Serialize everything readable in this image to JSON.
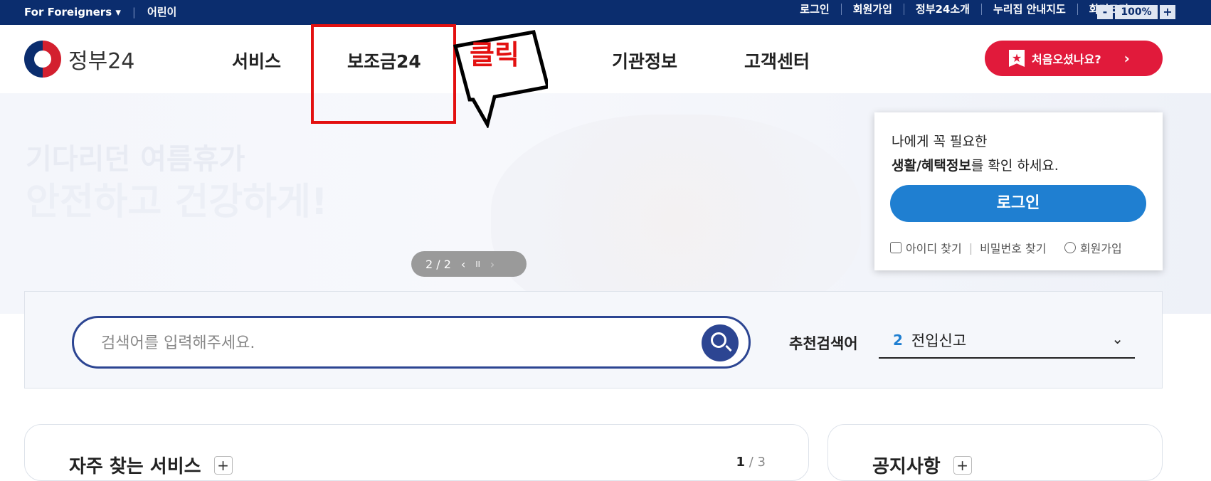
{
  "topbar": {
    "left": [
      "For Foreigners ▾",
      "어린이"
    ],
    "right": [
      "로그인",
      "회원가입",
      "정부24소개",
      "누리집 안내지도",
      "화면크기"
    ],
    "zoom": {
      "minus": "-",
      "value": "100%",
      "plus": "+"
    }
  },
  "header": {
    "logo_text": "정부24",
    "nav": [
      "서비스",
      "보조금24",
      "",
      "기관정보",
      "고객센터"
    ],
    "cta_label": "처음오셨나요?",
    "cta_arrow": "›"
  },
  "hero": {
    "ghost_line1": "기다리던 여름휴가",
    "ghost_line2": "안전하고 건강하게!",
    "pager": {
      "text": "2 / 2",
      "prev": "‹",
      "pause": "II",
      "next": "›"
    }
  },
  "login_card": {
    "line1": "나에게 꼭 필요한",
    "line2_bold": "생활/혜택정보",
    "line2_rest": "를 확인 하세요.",
    "login_button": "로그인",
    "links": [
      "아이디 찾기",
      "비밀번호 찾기",
      "회원가입"
    ]
  },
  "search": {
    "placeholder": "검색어를 입력해주세요.",
    "rec_label": "추천검색어",
    "rec_num": "2",
    "rec_value": "전입신고"
  },
  "cards": {
    "left": {
      "title": "자주 찾는 서비스",
      "plus": "+",
      "page_current": "1",
      "page_total": "/ 3"
    },
    "right": {
      "title": "공지사항",
      "plus": "+"
    }
  },
  "annotation": {
    "label": "클릭"
  }
}
